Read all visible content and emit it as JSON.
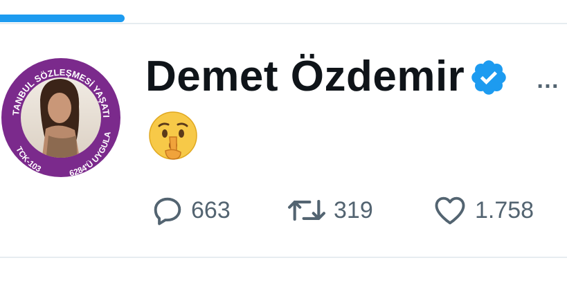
{
  "progress": {
    "fraction": 0.22,
    "color": "#1d9bf0"
  },
  "tweet": {
    "author": {
      "display_name": "Demet Özdemir",
      "verified": true,
      "avatar_ring_text": {
        "top": "İSTANBUL SÖZLEŞMESİ YAŞATIR",
        "bottom_left": "TCK-103",
        "bottom_right": "6284'Ü UYGULA"
      },
      "avatar_ring_color": "#7b2a8c"
    },
    "more_label": "…",
    "content_emoji": "shushing-face-emoji",
    "actions": {
      "reply": {
        "icon": "reply-icon",
        "count": "663"
      },
      "retweet": {
        "icon": "retweet-icon",
        "count": "319"
      },
      "like": {
        "icon": "heart-icon",
        "count": "1.758"
      }
    }
  },
  "colors": {
    "text": "#0f1419",
    "secondary": "#536471",
    "verified": "#1d9bf0",
    "divider": "#e6ecf0"
  }
}
